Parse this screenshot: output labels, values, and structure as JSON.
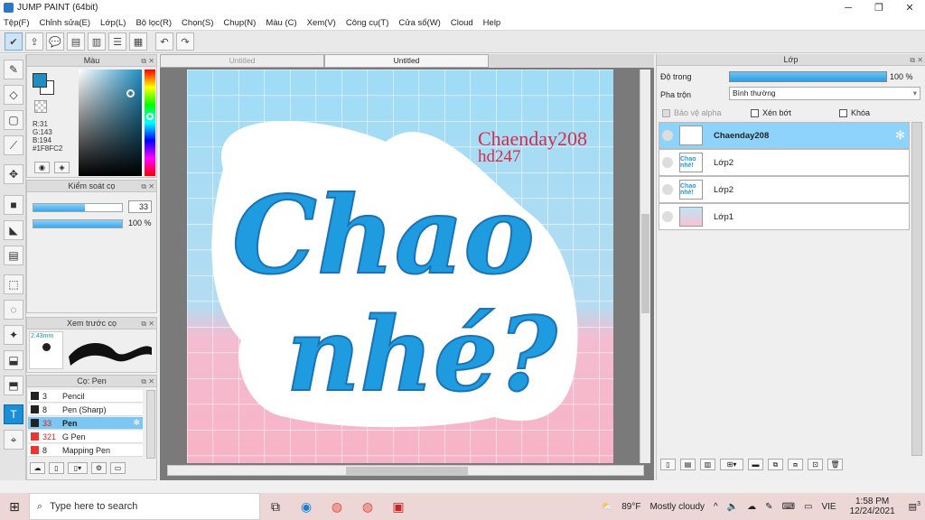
{
  "window": {
    "title": "JUMP PAINT (64bit)",
    "controls": [
      "─",
      "❐",
      "✕"
    ]
  },
  "menu": [
    "Tệp(F)",
    "Chỉnh sửa(E)",
    "Lớp(L)",
    "Bộ lọc(R)",
    "Chọn(S)",
    "Chụp(N)",
    "Màu (C)",
    "Xem(V)",
    "Công cụ(T)",
    "Cửa sổ(W)",
    "Cloud",
    "Help"
  ],
  "color_panel": {
    "title": "Màu",
    "r": "R:31",
    "g": "G:143",
    "b": "B:194",
    "hex": "#1F8FC2",
    "color": "#1f8fc2"
  },
  "brush_control": {
    "title": "Kiểm soát cọ",
    "size": "33",
    "opacity": "100 %",
    "size_fraction": 0.58,
    "opacity_fraction": 1.0
  },
  "brush_preview": {
    "title": "Xem trước cọ",
    "size_label": "2.43mm"
  },
  "brushes": {
    "title": "Cọ: Pen",
    "items": [
      {
        "size": "3",
        "name": "Pencil"
      },
      {
        "size": "8",
        "name": "Pen (Sharp)"
      },
      {
        "size": "33",
        "name": "Pen"
      },
      {
        "size": "321",
        "name": "G Pen"
      },
      {
        "size": "8",
        "name": "Mapping Pen"
      }
    ]
  },
  "tabs": [
    "Untitled",
    "Untitled"
  ],
  "canvas_art": {
    "line1": "Chaenday208",
    "line2": "hd247",
    "word1": "Chao",
    "word2": "nhé?"
  },
  "layers": {
    "title": "Lớp",
    "opacity_label": "Độ trong",
    "opacity_value": "100 %",
    "blend_label": "Pha trộn",
    "blend_value": "Bình thường",
    "protect_alpha": "Bảo vệ alpha",
    "clipping": "Xén bớt",
    "lock": "Khóa",
    "items": [
      {
        "name": "Chaenday208",
        "thumb": ""
      },
      {
        "name": "Lớp2",
        "thumb": "Chao nhé!"
      },
      {
        "name": "Lớp2",
        "thumb": "Chao nhé!"
      },
      {
        "name": "Lớp1",
        "thumb": ""
      }
    ]
  },
  "taskbar": {
    "search_placeholder": "Type here to search",
    "weather_temp": "89°F",
    "weather_desc": "Mostly cloudy",
    "lang": "VIE",
    "time": "1:58 PM",
    "date": "12/24/2021",
    "notif_count": "3"
  }
}
